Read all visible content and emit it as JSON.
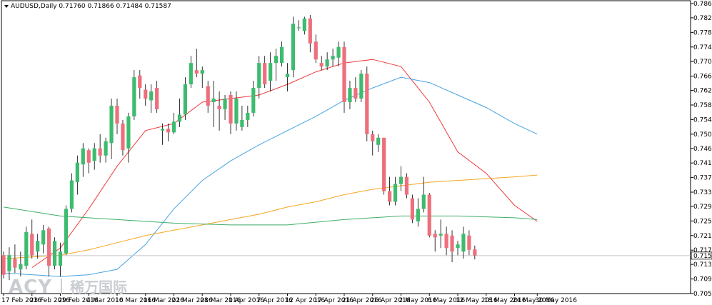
{
  "window": {
    "dropdown_icon": "triangle-down-icon"
  },
  "watermark": {
    "logo_text": "ACY",
    "chinese_text": "稀万国际"
  },
  "colors": {
    "bull": "#3dbb6e",
    "bear": "#ee6f7c",
    "ma_red": "#ee3a3a",
    "ma_blue": "#47a3e0",
    "ma_orange": "#f5a623",
    "ma_green": "#3fae68",
    "current_line": "#c8c8c8"
  },
  "chart_data": {
    "type": "candlestick",
    "title": "AUDUSD,Daily  0.71760 0.71866 0.71484 0.71587",
    "symbol": "AUDUSD",
    "timeframe": "Daily",
    "ohlc_header": {
      "open": 0.7176,
      "high": 0.71866,
      "low": 0.71484,
      "close": 0.71587
    },
    "current_price": 0.71587,
    "current_price_label": "0.71587",
    "ylim": [
      0.7052,
      0.7867
    ],
    "y_ticks": [
      "0.78670",
      "0.78270",
      "0.77860",
      "0.77450",
      "0.77040",
      "0.76630",
      "0.76230",
      "0.75820",
      "0.75410",
      "0.75000",
      "0.74600",
      "0.74190",
      "0.73780",
      "0.73370",
      "0.72970",
      "0.72560",
      "0.72150",
      "0.71740",
      "0.71340",
      "0.70930",
      "0.70520"
    ],
    "x_labels": [
      {
        "index": 0,
        "label": "17 Feb 2016"
      },
      {
        "index": 5,
        "label": "23 Feb 2016"
      },
      {
        "index": 10,
        "label": "29 Feb 2016"
      },
      {
        "index": 15,
        "label": "4 Mar 2016"
      },
      {
        "index": 20,
        "label": "10 Mar 2016"
      },
      {
        "index": 25,
        "label": "16 Mar 2016"
      },
      {
        "index": 30,
        "label": "22 Mar 2016"
      },
      {
        "index": 35,
        "label": "28 Mar 2016"
      },
      {
        "index": 40,
        "label": "1 Apr 2016"
      },
      {
        "index": 45,
        "label": "7 Apr 2016"
      },
      {
        "index": 50,
        "label": "12 Apr 2016"
      },
      {
        "index": 55,
        "label": "17 Apr 2016"
      },
      {
        "index": 60,
        "label": "21 Apr 2016"
      },
      {
        "index": 65,
        "label": "26 Apr 2016"
      },
      {
        "index": 70,
        "label": "2 May 2016"
      },
      {
        "index": 75,
        "label": "6 May 2016"
      },
      {
        "index": 80,
        "label": "12 May 2016"
      },
      {
        "index": 85,
        "label": "18 May 2016"
      },
      {
        "index": 90,
        "label": "24 May 2016"
      },
      {
        "index": 94,
        "label": "30 May 2016"
      }
    ],
    "candles": [
      [
        0.716,
        0.717,
        0.7095,
        0.7105
      ],
      [
        0.7115,
        0.7182,
        0.709,
        0.716
      ],
      [
        0.715,
        0.719,
        0.711,
        0.7125
      ],
      [
        0.712,
        0.717,
        0.71,
        0.7135
      ],
      [
        0.713,
        0.724,
        0.712,
        0.7225
      ],
      [
        0.722,
        0.726,
        0.715,
        0.716
      ],
      [
        0.717,
        0.722,
        0.715,
        0.72
      ],
      [
        0.719,
        0.7245,
        0.7165,
        0.723
      ],
      [
        0.7235,
        0.724,
        0.71,
        0.713
      ],
      [
        0.713,
        0.721,
        0.712,
        0.72
      ],
      [
        0.713,
        0.7195,
        0.71,
        0.717
      ],
      [
        0.7165,
        0.73,
        0.716,
        0.729
      ],
      [
        0.729,
        0.739,
        0.728,
        0.737
      ],
      [
        0.7365,
        0.744,
        0.733,
        0.742
      ],
      [
        0.7415,
        0.7475,
        0.738,
        0.746
      ],
      [
        0.7455,
        0.746,
        0.739,
        0.742
      ],
      [
        0.7425,
        0.7475,
        0.74,
        0.746
      ],
      [
        0.746,
        0.75,
        0.742,
        0.744
      ],
      [
        0.744,
        0.749,
        0.742,
        0.748
      ],
      [
        0.7475,
        0.76,
        0.743,
        0.758
      ],
      [
        0.758,
        0.76,
        0.75,
        0.753
      ],
      [
        0.753,
        0.754,
        0.744,
        0.7455
      ],
      [
        0.746,
        0.756,
        0.742,
        0.755
      ],
      [
        0.755,
        0.768,
        0.754,
        0.766
      ],
      [
        0.7665,
        0.768,
        0.76,
        0.763
      ],
      [
        0.7625,
        0.764,
        0.758,
        0.76
      ],
      [
        0.7595,
        0.764,
        0.756,
        0.762
      ],
      [
        0.763,
        0.765,
        0.756,
        0.757
      ],
      [
        0.751,
        0.753,
        0.747,
        0.7515
      ],
      [
        0.7515,
        0.753,
        0.748,
        0.7505
      ],
      [
        0.7505,
        0.756,
        0.75,
        0.7535
      ],
      [
        0.7535,
        0.76,
        0.752,
        0.7555
      ],
      [
        0.7555,
        0.766,
        0.754,
        0.764
      ],
      [
        0.764,
        0.772,
        0.763,
        0.77
      ],
      [
        0.768,
        0.774,
        0.766,
        0.767
      ],
      [
        0.767,
        0.769,
        0.763,
        0.768
      ],
      [
        0.7635,
        0.765,
        0.756,
        0.758
      ],
      [
        0.759,
        0.765,
        0.752,
        0.76
      ],
      [
        0.758,
        0.762,
        0.751,
        0.757
      ],
      [
        0.757,
        0.761,
        0.754,
        0.76
      ],
      [
        0.761,
        0.762,
        0.75,
        0.753
      ],
      [
        0.753,
        0.762,
        0.751,
        0.76
      ],
      [
        0.752,
        0.758,
        0.751,
        0.754
      ],
      [
        0.754,
        0.758,
        0.752,
        0.756
      ],
      [
        0.756,
        0.765,
        0.755,
        0.763
      ],
      [
        0.763,
        0.772,
        0.76,
        0.77
      ],
      [
        0.77,
        0.772,
        0.763,
        0.764
      ],
      [
        0.765,
        0.773,
        0.762,
        0.77
      ],
      [
        0.77,
        0.774,
        0.765,
        0.772
      ],
      [
        0.77,
        0.776,
        0.769,
        0.7745
      ],
      [
        0.766,
        0.77,
        0.762,
        0.767
      ],
      [
        0.768,
        0.783,
        0.766,
        0.781
      ],
      [
        0.78,
        0.782,
        0.779,
        0.78
      ],
      [
        0.779,
        0.783,
        0.778,
        0.7825
      ],
      [
        0.7825,
        0.7835,
        0.773,
        0.7755
      ],
      [
        0.776,
        0.778,
        0.77,
        0.771
      ],
      [
        0.77,
        0.772,
        0.768,
        0.769
      ],
      [
        0.769,
        0.773,
        0.768,
        0.771
      ],
      [
        0.771,
        0.774,
        0.769,
        0.772
      ],
      [
        0.7715,
        0.776,
        0.769,
        0.7745
      ],
      [
        0.7745,
        0.776,
        0.756,
        0.759
      ],
      [
        0.759,
        0.765,
        0.757,
        0.763
      ],
      [
        0.763,
        0.766,
        0.759,
        0.76
      ],
      [
        0.76,
        0.768,
        0.759,
        0.767
      ],
      [
        0.767,
        0.769,
        0.748,
        0.75
      ],
      [
        0.75,
        0.751,
        0.744,
        0.748
      ],
      [
        0.747,
        0.75,
        0.745,
        0.749
      ],
      [
        0.749,
        0.749,
        0.733,
        0.734
      ],
      [
        0.734,
        0.738,
        0.73,
        0.731
      ],
      [
        0.731,
        0.738,
        0.73,
        0.736
      ],
      [
        0.736,
        0.741,
        0.734,
        0.738
      ],
      [
        0.738,
        0.739,
        0.732,
        0.733
      ],
      [
        0.732,
        0.733,
        0.725,
        0.726
      ],
      [
        0.7255,
        0.732,
        0.724,
        0.729
      ],
      [
        0.729,
        0.738,
        0.728,
        0.733
      ],
      [
        0.733,
        0.7335,
        0.721,
        0.7215
      ],
      [
        0.722,
        0.723,
        0.717,
        0.721
      ],
      [
        0.7215,
        0.726,
        0.718,
        0.722
      ],
      [
        0.722,
        0.724,
        0.716,
        0.718
      ],
      [
        0.7215,
        0.723,
        0.714,
        0.717
      ],
      [
        0.718,
        0.72,
        0.716,
        0.719
      ],
      [
        0.717,
        0.724,
        0.715,
        0.722
      ],
      [
        0.7215,
        0.723,
        0.716,
        0.7175
      ],
      [
        0.7176,
        0.7187,
        0.7148,
        0.7159
      ]
    ],
    "series": [
      {
        "kind": "moving-average",
        "color": "#ee3a3a",
        "points": [
          [
            5,
            0.7125
          ],
          [
            10,
            0.718
          ],
          [
            15,
            0.729
          ],
          [
            20,
            0.741
          ],
          [
            25,
            0.751
          ],
          [
            30,
            0.753
          ],
          [
            35,
            0.759
          ],
          [
            40,
            0.76
          ],
          [
            45,
            0.761
          ],
          [
            50,
            0.764
          ],
          [
            55,
            0.7675
          ],
          [
            60,
            0.77
          ],
          [
            65,
            0.771
          ],
          [
            70,
            0.769
          ],
          [
            75,
            0.759
          ],
          [
            80,
            0.745
          ],
          [
            85,
            0.739
          ],
          [
            90,
            0.73
          ],
          [
            94,
            0.7255
          ]
        ]
      },
      {
        "kind": "moving-average",
        "color": "#47a3e0",
        "points": [
          [
            0,
            0.711
          ],
          [
            10,
            0.71
          ],
          [
            15,
            0.7105
          ],
          [
            20,
            0.712
          ],
          [
            25,
            0.719
          ],
          [
            30,
            0.729
          ],
          [
            35,
            0.737
          ],
          [
            40,
            0.7425
          ],
          [
            45,
            0.747
          ],
          [
            50,
            0.751
          ],
          [
            55,
            0.755
          ],
          [
            60,
            0.7595
          ],
          [
            65,
            0.763
          ],
          [
            70,
            0.766
          ],
          [
            75,
            0.7645
          ],
          [
            80,
            0.761
          ],
          [
            85,
            0.7575
          ],
          [
            90,
            0.753
          ],
          [
            94,
            0.75
          ]
        ]
      },
      {
        "kind": "moving-average",
        "color": "#f5a623",
        "points": [
          [
            0,
            0.715
          ],
          [
            10,
            0.716
          ],
          [
            15,
            0.7175
          ],
          [
            20,
            0.7195
          ],
          [
            25,
            0.7215
          ],
          [
            30,
            0.723
          ],
          [
            35,
            0.7245
          ],
          [
            40,
            0.726
          ],
          [
            45,
            0.7275
          ],
          [
            50,
            0.7295
          ],
          [
            55,
            0.731
          ],
          [
            60,
            0.733
          ],
          [
            65,
            0.7345
          ],
          [
            70,
            0.7355
          ],
          [
            75,
            0.7365
          ],
          [
            80,
            0.737
          ],
          [
            85,
            0.7375
          ],
          [
            90,
            0.738
          ],
          [
            94,
            0.7385
          ]
        ]
      },
      {
        "kind": "moving-average",
        "color": "#3fae68",
        "points": [
          [
            0,
            0.7295
          ],
          [
            10,
            0.727
          ],
          [
            20,
            0.726
          ],
          [
            30,
            0.725
          ],
          [
            40,
            0.7245
          ],
          [
            50,
            0.7245
          ],
          [
            60,
            0.726
          ],
          [
            70,
            0.727
          ],
          [
            80,
            0.727
          ],
          [
            90,
            0.7265
          ],
          [
            94,
            0.726
          ]
        ]
      }
    ],
    "grid": false,
    "legend": "none"
  }
}
